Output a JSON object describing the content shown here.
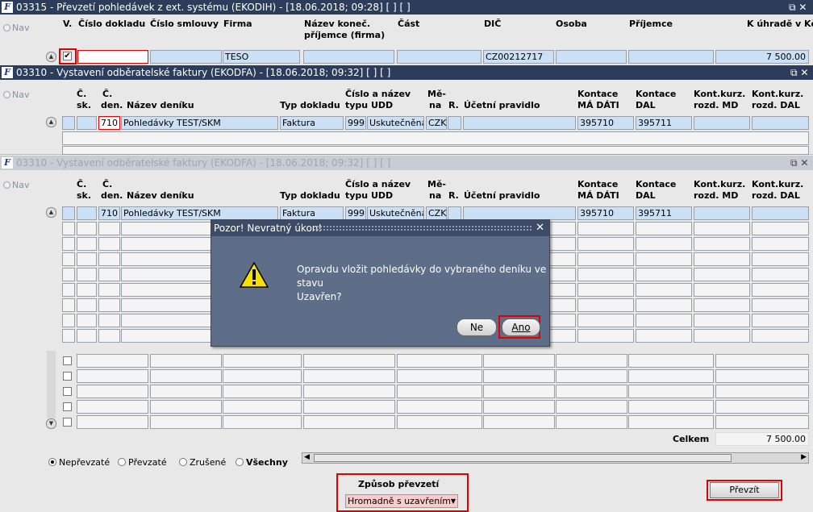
{
  "win1": {
    "title": "03315 - Převzetí pohledávek z ext. systému (EKODIH) - [18.06.2018; 09:28]  [ ]  [ ]",
    "controls": "⧉ ✕",
    "nav": "Nav",
    "headers": {
      "v": "V.",
      "cislo_dokladu": "Číslo dokladu",
      "cislo_smlouvy": "Číslo smlouvy",
      "firma": "Firma",
      "nazev_konec_1": "Název koneč.",
      "nazev_konec_2": "příjemce (firma)",
      "cast": "Část",
      "dic": "DIČ",
      "osoba": "Osoba",
      "prijemce": "Příjemce",
      "k_uhrade": "K úhradě v Kč"
    },
    "row": {
      "firma": "TESO",
      "dic": "CZ00212717",
      "k_uhrade": "7 500.00"
    },
    "celkem_label": "Celkem",
    "celkem_value": "7 500.00",
    "radios": [
      {
        "label": "Nepřevzaté",
        "selected": true
      },
      {
        "label": "Převzaté",
        "selected": false
      },
      {
        "label": "Zrušené",
        "selected": false
      },
      {
        "label": "Všechny",
        "selected": false
      }
    ],
    "zpusob_label": "Způsob převzetí",
    "zpusob_value": "Hromadně s uzavřením",
    "prevzit": "Převzít"
  },
  "win2": {
    "title": "03310 - Vystavení odběratelské faktury (EKODFA) - [18.06.2018; 09:32]  [ ]  [ ]",
    "controls": "⧉ ✕",
    "nav": "Nav",
    "headers": {
      "c_sk_1": "Č.",
      "c_sk_2": "sk.",
      "c_den_1": "Č.",
      "c_den_2": "den.",
      "nazev_deniku": "Název deníku",
      "typ_dokladu": "Typ dokladu",
      "cislo_nazev_1": "Číslo a název",
      "cislo_nazev_2": "typu UDD",
      "mena_1": "Mě-",
      "mena_2": "na",
      "r": "R.",
      "ucetni": "Účetní pravidlo",
      "md_1": "Kontace",
      "md_2": "MÁ DÁTI",
      "dal_1": "Kontace",
      "dal_2": "DAL",
      "kmd_1": "Kont.kurz.",
      "kmd_2": "rozd. MD",
      "kdal_1": "Kont.kurz.",
      "kdal_2": "rozd. DAL"
    },
    "row": {
      "den": "710",
      "nazev": "Pohledávky TEST/SKM",
      "typ": "Faktura",
      "udd_cislo": "999",
      "udd_nazev": "Uskutečněná",
      "mena": "CZK",
      "md": "395710",
      "dal": "395711"
    }
  },
  "win3": {
    "title": "03310 - Vystavení odběratelské faktury (EKODFA) - [18.06.2018; 09:32]  [ ]  [ ]",
    "controls": "⧉ ✕",
    "nav": "Nav"
  },
  "dialog": {
    "title": "Pozor! Nevratný úkon!",
    "close": "✕",
    "message_1": "Opravdu vložit pohledávky do vybraného deníku ve stavu",
    "message_2": "Uzavřen?",
    "btn_ne": "Ne",
    "btn_ano": "Ano"
  }
}
